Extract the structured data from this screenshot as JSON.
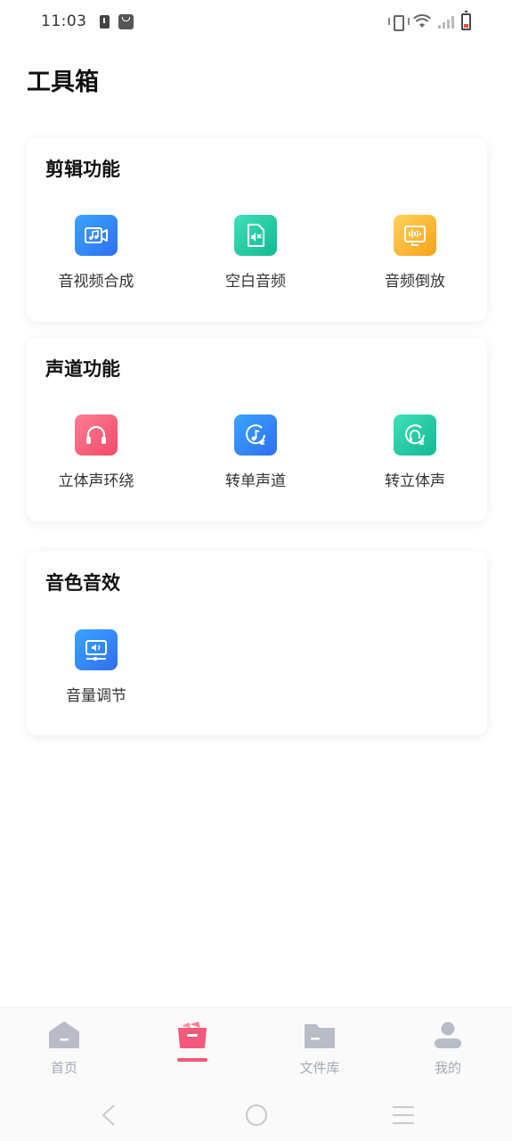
{
  "status_bar": {
    "time": "11:03"
  },
  "page_title": "工具箱",
  "sections": [
    {
      "title": "剪辑功能",
      "tools": [
        {
          "label": "音视频合成",
          "icon": "video-audio-merge-icon",
          "color_from": "#3aa4ff",
          "color_to": "#2f6ff0"
        },
        {
          "label": "空白音频",
          "icon": "mute-file-icon",
          "color_from": "#3de0b8",
          "color_to": "#14b891"
        },
        {
          "label": "音频倒放",
          "icon": "audio-reverse-icon",
          "color_from": "#ffd15a",
          "color_to": "#f7a21b"
        }
      ]
    },
    {
      "title": "声道功能",
      "tools": [
        {
          "label": "立体声环绕",
          "icon": "headphones-icon",
          "color_from": "#ff7e93",
          "color_to": "#f04a6a"
        },
        {
          "label": "转单声道",
          "icon": "mono-channel-icon",
          "color_from": "#3aa4ff",
          "color_to": "#2f6ff0"
        },
        {
          "label": "转立体声",
          "icon": "stereo-channel-icon",
          "color_from": "#3de0b8",
          "color_to": "#14b891"
        }
      ]
    },
    {
      "title": "音色音效",
      "tools": [
        {
          "label": "音量调节",
          "icon": "volume-adjust-icon",
          "color_from": "#3aa4ff",
          "color_to": "#2f6ff0"
        }
      ]
    }
  ],
  "tabbar": {
    "home": "首页",
    "files": "文件库",
    "mine": "我的",
    "active_color": "#f2597a",
    "inactive_color": "#a3a8b3"
  }
}
